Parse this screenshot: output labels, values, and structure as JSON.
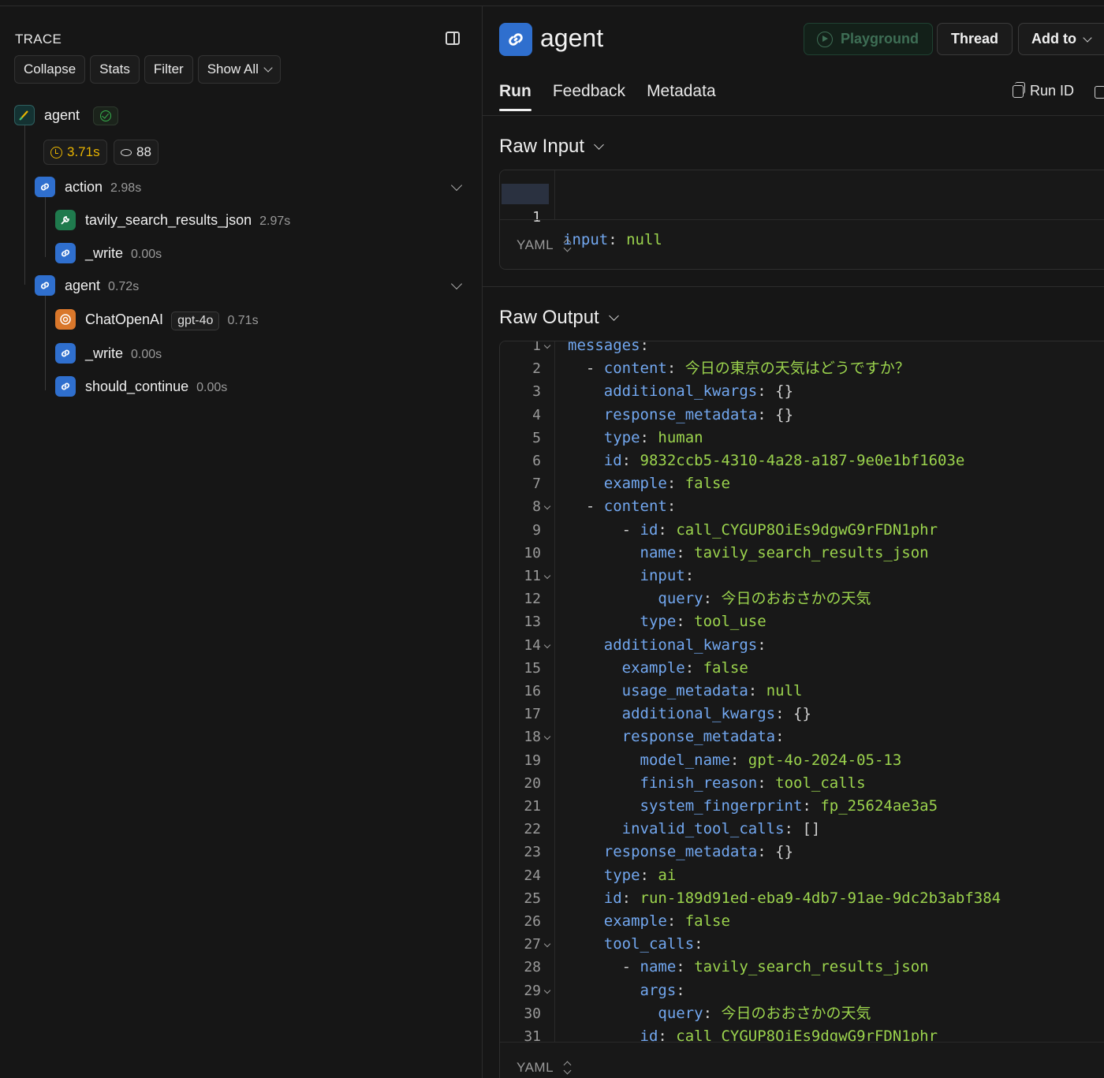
{
  "trace": {
    "title": "TRACE",
    "buttons": [
      "Collapse",
      "Stats",
      "Filter",
      "Show All"
    ],
    "root": {
      "label": "agent",
      "latency": "3.71s",
      "tokens": "88"
    },
    "nodes": [
      {
        "label": "action",
        "time": "2.98s"
      },
      {
        "label": "tavily_search_results_json",
        "time": "2.97s"
      },
      {
        "label": "_write",
        "time": "0.00s"
      },
      {
        "label": "agent",
        "time": "0.72s"
      },
      {
        "label": "ChatOpenAI",
        "model": "gpt-4o",
        "time": "0.71s"
      },
      {
        "label": "_write",
        "time": "0.00s"
      },
      {
        "label": "should_continue",
        "time": "0.00s"
      }
    ]
  },
  "header": {
    "title": "agent",
    "playground": "Playground",
    "thread": "Thread",
    "add_to": "Add to"
  },
  "tabs": [
    "Run",
    "Feedback",
    "Metadata"
  ],
  "run_id_label": "Run ID",
  "raw_input": {
    "title": "Raw Input",
    "line_no": "1",
    "key": "input",
    "value": "null",
    "format": "YAML"
  },
  "raw_output": {
    "title": "Raw Output",
    "format": "YAML",
    "lines": [
      {
        "n": "1",
        "fold": true,
        "indent": "",
        "dash": false,
        "key": "messages",
        "value": ""
      },
      {
        "n": "2",
        "fold": false,
        "indent": "  ",
        "dash": true,
        "key": "content",
        "value": "今日の東京の天気はどうですか？"
      },
      {
        "n": "3",
        "fold": false,
        "indent": "    ",
        "dash": false,
        "key": "additional_kwargs",
        "value": "{}"
      },
      {
        "n": "4",
        "fold": false,
        "indent": "    ",
        "dash": false,
        "key": "response_metadata",
        "value": "{}"
      },
      {
        "n": "5",
        "fold": false,
        "indent": "    ",
        "dash": false,
        "key": "type",
        "value": "human"
      },
      {
        "n": "6",
        "fold": false,
        "indent": "    ",
        "dash": false,
        "key": "id",
        "value": "9832ccb5-4310-4a28-a187-9e0e1bf1603e"
      },
      {
        "n": "7",
        "fold": false,
        "indent": "    ",
        "dash": false,
        "key": "example",
        "value": "false"
      },
      {
        "n": "8",
        "fold": true,
        "indent": "  ",
        "dash": true,
        "key": "content",
        "value": ""
      },
      {
        "n": "9",
        "fold": false,
        "indent": "      ",
        "dash": true,
        "key": "id",
        "value": "call_CYGUP8OiEs9dgwG9rFDN1phr"
      },
      {
        "n": "10",
        "fold": false,
        "indent": "        ",
        "dash": false,
        "key": "name",
        "value": "tavily_search_results_json"
      },
      {
        "n": "11",
        "fold": true,
        "indent": "        ",
        "dash": false,
        "key": "input",
        "value": ""
      },
      {
        "n": "12",
        "fold": false,
        "indent": "          ",
        "dash": false,
        "key": "query",
        "value": "今日のおおさかの天気"
      },
      {
        "n": "13",
        "fold": false,
        "indent": "        ",
        "dash": false,
        "key": "type",
        "value": "tool_use"
      },
      {
        "n": "14",
        "fold": true,
        "indent": "    ",
        "dash": false,
        "key": "additional_kwargs",
        "value": ""
      },
      {
        "n": "15",
        "fold": false,
        "indent": "      ",
        "dash": false,
        "key": "example",
        "value": "false"
      },
      {
        "n": "16",
        "fold": false,
        "indent": "      ",
        "dash": false,
        "key": "usage_metadata",
        "value": "null"
      },
      {
        "n": "17",
        "fold": false,
        "indent": "      ",
        "dash": false,
        "key": "additional_kwargs",
        "value": "{}"
      },
      {
        "n": "18",
        "fold": true,
        "indent": "      ",
        "dash": false,
        "key": "response_metadata",
        "value": ""
      },
      {
        "n": "19",
        "fold": false,
        "indent": "        ",
        "dash": false,
        "key": "model_name",
        "value": "gpt-4o-2024-05-13"
      },
      {
        "n": "20",
        "fold": false,
        "indent": "        ",
        "dash": false,
        "key": "finish_reason",
        "value": "tool_calls"
      },
      {
        "n": "21",
        "fold": false,
        "indent": "        ",
        "dash": false,
        "key": "system_fingerprint",
        "value": "fp_25624ae3a5"
      },
      {
        "n": "22",
        "fold": false,
        "indent": "      ",
        "dash": false,
        "key": "invalid_tool_calls",
        "value": "[]"
      },
      {
        "n": "23",
        "fold": false,
        "indent": "    ",
        "dash": false,
        "key": "response_metadata",
        "value": "{}"
      },
      {
        "n": "24",
        "fold": false,
        "indent": "    ",
        "dash": false,
        "key": "type",
        "value": "ai"
      },
      {
        "n": "25",
        "fold": false,
        "indent": "    ",
        "dash": false,
        "key": "id",
        "value": "run-189d91ed-eba9-4db7-91ae-9dc2b3abf384"
      },
      {
        "n": "26",
        "fold": false,
        "indent": "    ",
        "dash": false,
        "key": "example",
        "value": "false"
      },
      {
        "n": "27",
        "fold": true,
        "indent": "    ",
        "dash": false,
        "key": "tool_calls",
        "value": ""
      },
      {
        "n": "28",
        "fold": false,
        "indent": "      ",
        "dash": true,
        "key": "name",
        "value": "tavily_search_results_json"
      },
      {
        "n": "29",
        "fold": true,
        "indent": "        ",
        "dash": false,
        "key": "args",
        "value": ""
      },
      {
        "n": "30",
        "fold": false,
        "indent": "          ",
        "dash": false,
        "key": "query",
        "value": "今日のおおさかの天気"
      },
      {
        "n": "31",
        "fold": false,
        "indent": "        ",
        "dash": false,
        "key": "id",
        "value": "call_CYGUP8OiEs9dgwG9rFDN1phr"
      }
    ]
  },
  "colors": {
    "key": "#72a7ef",
    "value": "#9bd34d",
    "chain_icon": "#2f6fce",
    "tool_icon": "#1f7a4d",
    "llm_icon": "#d9772b",
    "latency": "#e8b400",
    "success": "#37b24d"
  }
}
